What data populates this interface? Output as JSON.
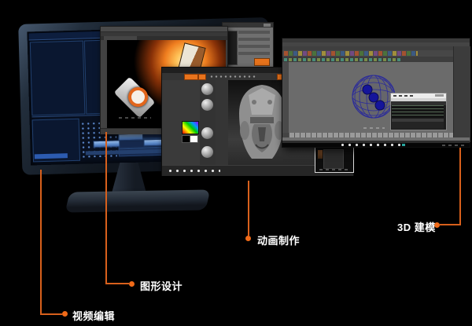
{
  "colors": {
    "accent_orange": "#e8671f",
    "background": "#000000",
    "monitor_screen_blue": "#0a1730",
    "maya_viewport_gray": "#6b6b6b",
    "zbrush_panel_gray": "#3a3a3a",
    "photoshop_chrome_gray": "#3d3d3d"
  },
  "callouts": {
    "video_editing": {
      "label": "视频编辑"
    },
    "graphic_design": {
      "label": "图形设计"
    },
    "animation": {
      "label": "动画制作"
    },
    "modeling": {
      "label": "3D 建模"
    }
  }
}
